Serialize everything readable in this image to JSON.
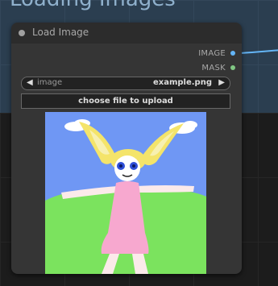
{
  "group": {
    "title": "Loading Images"
  },
  "node": {
    "title": "Load Image",
    "outputs": [
      {
        "label": "IMAGE",
        "color": "#64b5f6"
      },
      {
        "label": "MASK",
        "color": "#81c784"
      }
    ],
    "image_widget": {
      "label": "image",
      "value": "example.png",
      "left_arrow": "◀",
      "right_arrow": "▶"
    },
    "upload_button": {
      "label": "choose file to upload"
    },
    "preview": {
      "description_icon": "image-preview"
    }
  },
  "colors": {
    "node_bg": "#353535",
    "node_header": "#2c2c2c",
    "group_bg": "#2b3e50",
    "canvas_bg": "#1c1c1c",
    "link_image": "#64b5f6"
  }
}
